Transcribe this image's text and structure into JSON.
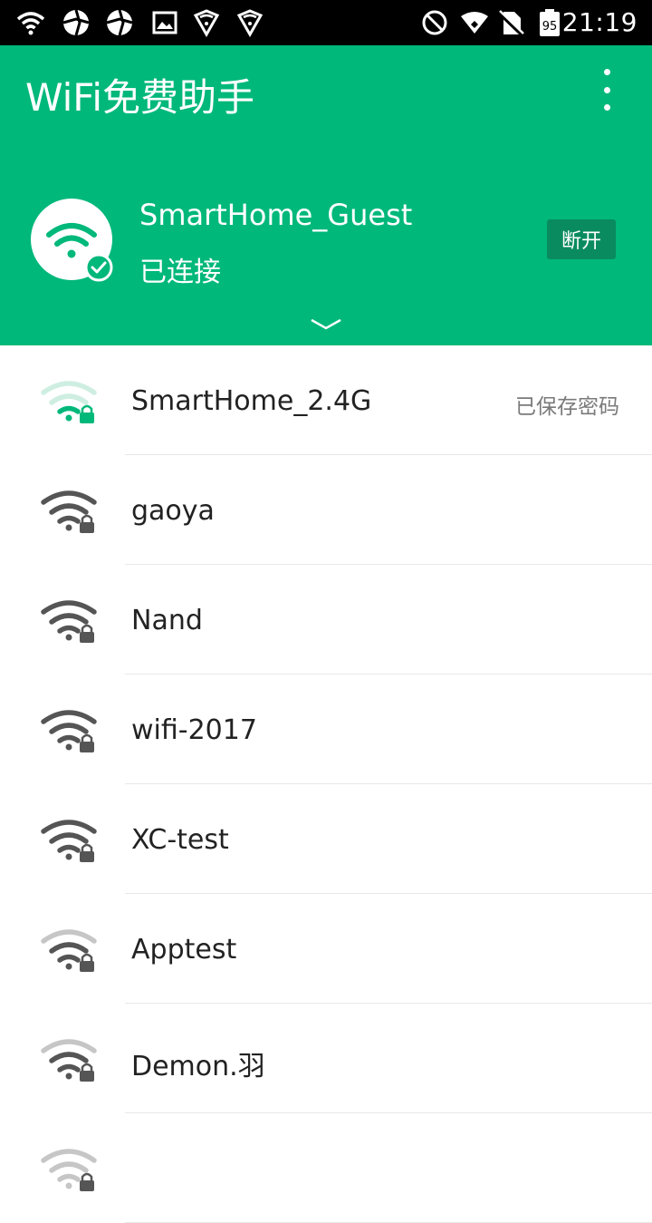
{
  "status_bar": {
    "time": "21:19",
    "battery_level": "95"
  },
  "app_bar": {
    "title": "WiFi免费助手"
  },
  "connected": {
    "ssid": "SmartHome_Guest",
    "status": "已连接",
    "disconnect_label": "断开"
  },
  "colors": {
    "primary": "#00b87a",
    "button_dark": "#0a8b5f",
    "signal_strong": "#555555",
    "signal_faint": "#c6c6c6"
  },
  "networks": [
    {
      "ssid": "SmartHome_2.4G",
      "saved": "已保存密码",
      "signal": 1,
      "color": "green"
    },
    {
      "ssid": "gaoya",
      "signal": 3,
      "color": "gray"
    },
    {
      "ssid": "Nand",
      "signal": 3,
      "color": "gray"
    },
    {
      "ssid": "wifi-2017",
      "signal": 3,
      "color": "gray"
    },
    {
      "ssid": "XC-test",
      "signal": 3,
      "color": "gray"
    },
    {
      "ssid": "Apptest",
      "signal": 2,
      "color": "gray"
    },
    {
      "ssid": "Demon.羽",
      "signal": 2,
      "color": "gray"
    },
    {
      "ssid": "",
      "signal": 0,
      "color": "gray"
    }
  ]
}
